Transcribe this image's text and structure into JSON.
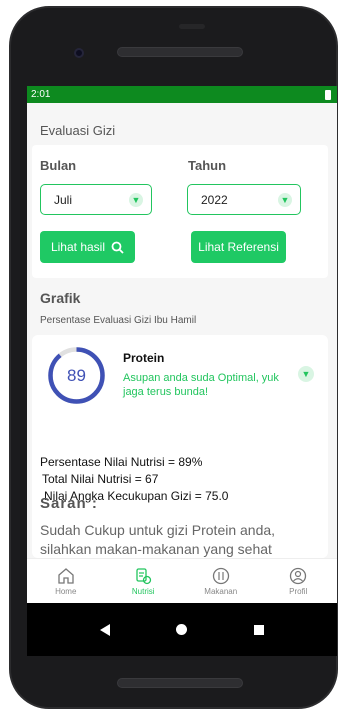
{
  "status": {
    "time": "2:01"
  },
  "page": {
    "title": "Evaluasi Gizi"
  },
  "filter": {
    "bulan_label": "Bulan",
    "tahun_label": "Tahun",
    "bulan_value": "Juli",
    "tahun_value": "2022",
    "lihat_hasil": "Lihat hasil",
    "lihat_referensi": "Lihat Referensi"
  },
  "grafik": {
    "title": "Grafik",
    "subtitle": "Persentase Evaluasi Gizi Ibu Hamil"
  },
  "result": {
    "score": "89",
    "score_fraction": 0.89,
    "nutrient": "Protein",
    "message": "Asupan anda suda Optimal, yuk jaga terus bunda!",
    "persentase": "Persentase Nilai Nutrisi = 89%",
    "total": "Total Nilai Nutrisi = 67",
    "akg": "Nilai Angka Kecukupan Gizi = 75.0"
  },
  "saran": {
    "title": "Saran :",
    "text": "Sudah Cukup untuk gizi Protein anda, silahkan makan-makanan yang sehat"
  },
  "nav": {
    "home": "Home",
    "nutrisi": "Nutrisi",
    "makanan": "Makanan",
    "profil": "Profil"
  },
  "colors": {
    "status_bar": "#0d8a1f",
    "accent": "#22c55e",
    "ring": "#3f51b5"
  }
}
